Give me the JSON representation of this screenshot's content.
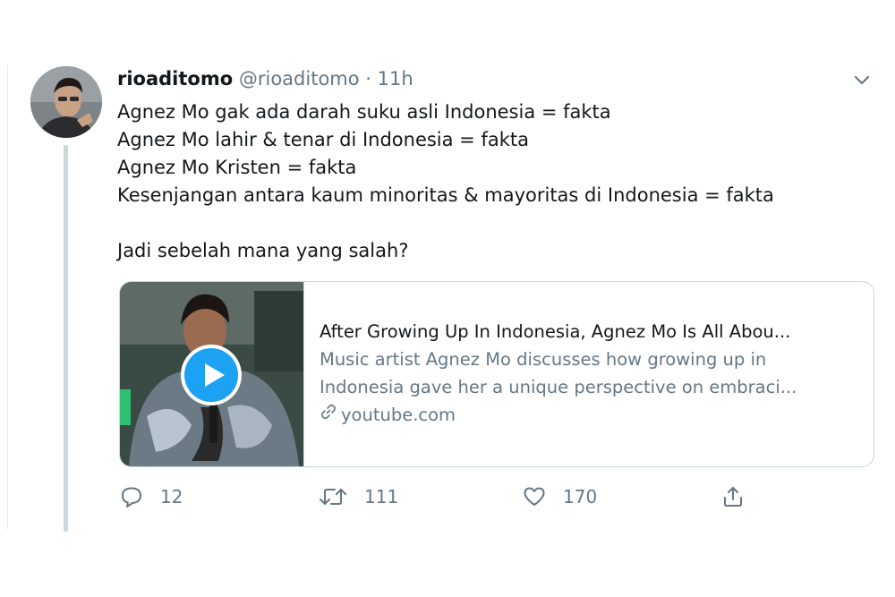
{
  "tweet": {
    "display_name": "rioaditomo",
    "handle": "@rioaditomo",
    "separator": "·",
    "time": "11h",
    "lines": [
      "Agnez Mo gak ada darah suku asli Indonesia = fakta",
      "Agnez Mo lahir & tenar di Indonesia = fakta",
      "Agnez Mo Kristen = fakta",
      "Kesenjangan antara kaum minoritas & mayoritas di Indonesia = fakta",
      "",
      "Jadi sebelah mana yang salah?"
    ]
  },
  "card": {
    "title": "After Growing Up In Indonesia, Agnez Mo Is All Abou...",
    "description_lines": [
      "Music artist Agnez Mo discusses how growing up in",
      "Indonesia gave her a unique perspective on embraci..."
    ],
    "domain": "youtube.com",
    "play_color": "#1da1f2"
  },
  "actions": {
    "reply_count": "12",
    "retweet_count": "111",
    "like_count": "170"
  },
  "icons": [
    "chevron-down-icon",
    "play-icon",
    "link-icon",
    "reply-icon",
    "retweet-icon",
    "like-icon",
    "share-icon"
  ],
  "colors": {
    "text_secondary": "#657786",
    "thread_line": "#ccd6dd",
    "accent": "#1da1f2"
  }
}
